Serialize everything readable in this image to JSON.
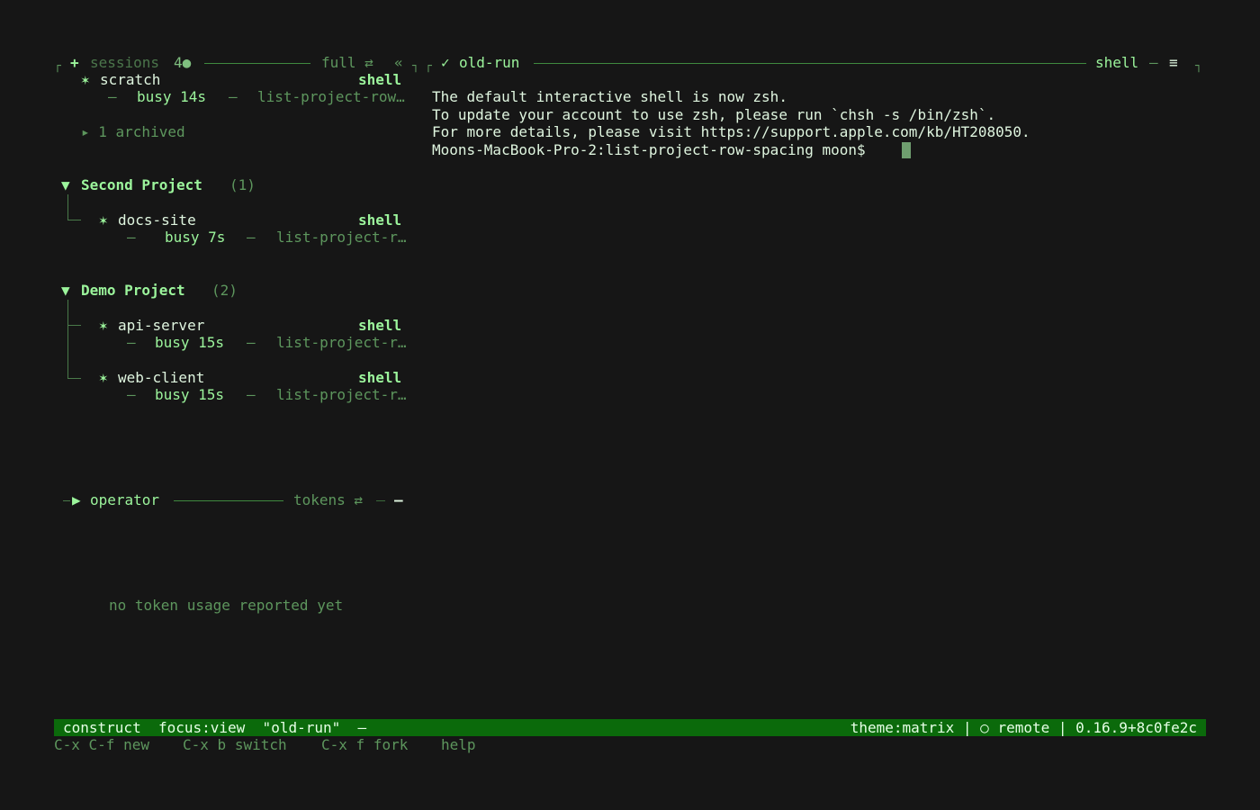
{
  "sidebar": {
    "header": {
      "plus": "+",
      "title": "sessions",
      "count": "4●",
      "mode": "full ⇄",
      "collapse": "«"
    },
    "scratch": {
      "star": "✶",
      "name": "scratch",
      "kind": "shell",
      "status_dash": "–",
      "status": "busy 14s",
      "sep": "–",
      "branch": "list-project-row…",
      "archived": "▸ 1 archived"
    },
    "projects": [
      {
        "arrow": "▼",
        "name": "Second Project",
        "count": "(1)",
        "sessions": [
          {
            "star": "✶",
            "name": "docs-site",
            "kind": "shell",
            "dash": "–",
            "status": "busy 7s",
            "sep": "–",
            "branch": "list-project-r…"
          }
        ]
      },
      {
        "arrow": "▼",
        "name": "Demo Project",
        "count": "(2)",
        "sessions": [
          {
            "star": "✶",
            "name": "api-server",
            "kind": "shell",
            "dash": "–",
            "status": "busy 15s",
            "sep": "–",
            "branch": "list-project-r…"
          },
          {
            "star": "✶",
            "name": "web-client",
            "kind": "shell",
            "dash": "–",
            "status": "busy 15s",
            "sep": "–",
            "branch": "list-project-r…"
          }
        ]
      }
    ],
    "operator": {
      "arrow": "▶",
      "title": "operator",
      "tokens": "tokens ⇄",
      "minimize": "–",
      "empty": "no token usage reported yet"
    }
  },
  "terminal": {
    "check": "✓",
    "title": "old-run",
    "kind": "shell",
    "kind_dash": "–",
    "menu": "≡",
    "lines": [
      "The default interactive shell is now zsh.",
      "To update your account to use zsh, please run `chsh -s /bin/zsh`.",
      "For more details, please visit https://support.apple.com/kb/HT208050.",
      "Moons-MacBook-Pro-2:list-project-row-spacing moon$ "
    ]
  },
  "statusbar": {
    "left": "construct  focus:view  \"old-run\"  –",
    "right": "theme:matrix | ○ remote | 0.16.9+8c0fe2c"
  },
  "hints": [
    {
      "keys": "C-x C-f",
      "action": "new"
    },
    {
      "keys": "C-x b",
      "action": "switch"
    },
    {
      "keys": "C-x f",
      "action": "fork"
    },
    {
      "keys": "",
      "action": "help"
    }
  ],
  "colors": {
    "background": "#161616",
    "accent": "#9cf59c",
    "status_bar": "#0b6a0b"
  }
}
